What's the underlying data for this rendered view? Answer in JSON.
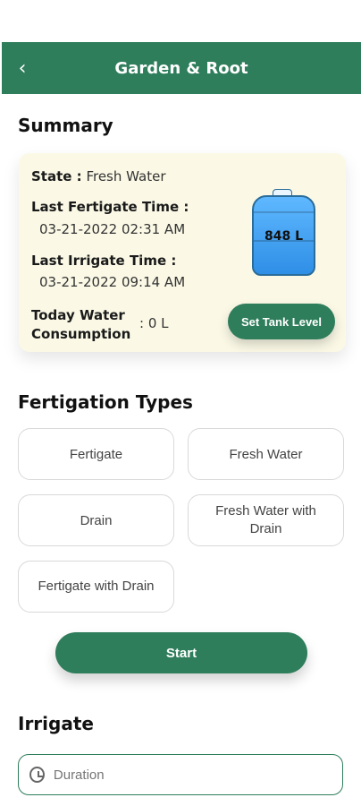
{
  "header": {
    "back_icon": "chevron-left-icon",
    "title": "Garden & Root"
  },
  "summary": {
    "section_title": "Summary",
    "state_label": "State :",
    "state_value": "Fresh Water",
    "last_fertigate_label": "Last Fertigate Time :",
    "last_fertigate_value": "03-21-2022 02:31 AM",
    "last_irrigate_label": "Last Irrigate Time :",
    "last_irrigate_value": "03-21-2022 09:14 AM",
    "today_consumption_label_line1": "Today Water",
    "today_consumption_label_line2": "Consumption",
    "today_consumption_value": ": 0 L",
    "tank": {
      "level_text": "848 L",
      "icon": "water-tank-icon"
    },
    "set_tank_button": "Set Tank Level"
  },
  "fertigation": {
    "section_title": "Fertigation Types",
    "types": [
      "Fertigate",
      "Fresh Water",
      "Drain",
      "Fresh Water with Drain",
      "Fertigate with Drain"
    ],
    "start_button": "Start"
  },
  "irrigate": {
    "section_title": "Irrigate",
    "duration_placeholder": "Duration",
    "duration_icon": "clock-icon"
  },
  "colors": {
    "primary": "#2e7d5b",
    "summary_bg": "#fbf9e6",
    "tank_blue": "#4aa8ff"
  }
}
